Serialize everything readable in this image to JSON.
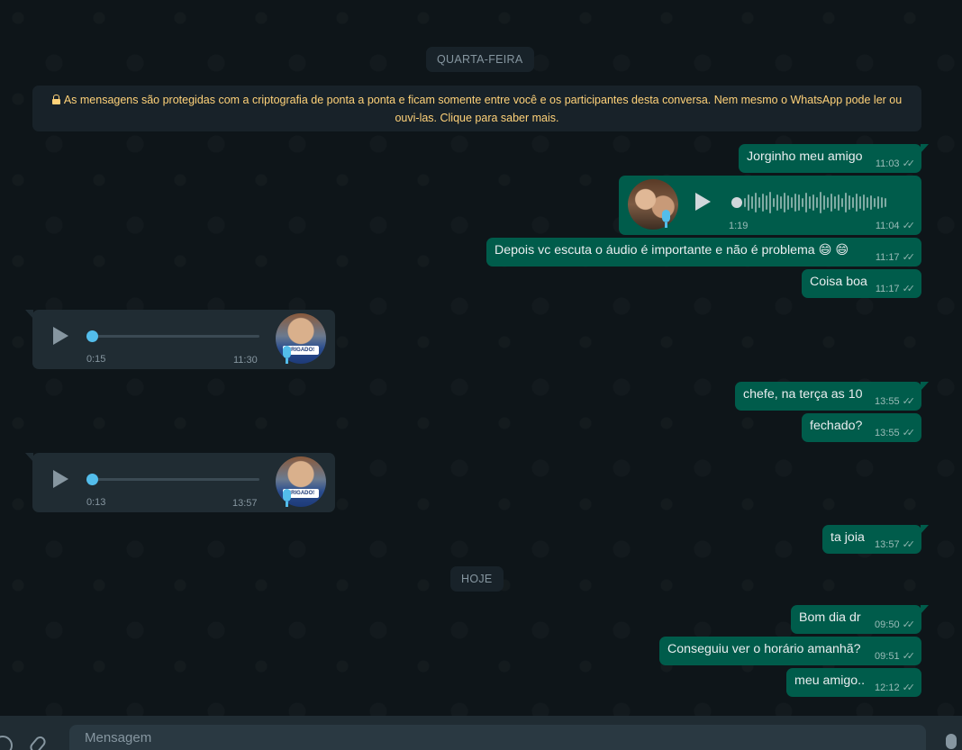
{
  "dates": {
    "wednesday": "QUARTA-FEIRA",
    "today": "HOJE"
  },
  "notice": "As mensagens são protegidas com a criptografia de ponta a ponta e ficam somente entre você e os participantes desta conversa. Nem mesmo o WhatsApp pode ler ou ouvi-las. Clique para saber mais.",
  "messages": {
    "m1": {
      "text": "Jorginho meu amigo",
      "time": "11:03"
    },
    "audio_out": {
      "duration": "1:19",
      "time": "11:04"
    },
    "m2": {
      "text": "Depois vc escuta o áudio é importante e não é problema 😄 😄",
      "time": "11:17"
    },
    "m3": {
      "text": "Coisa boa",
      "time": "11:17"
    },
    "audio_in_1": {
      "duration": "0:15",
      "time": "11:30",
      "badge": "BRIGADO!"
    },
    "m4": {
      "text": "chefe, na terça as 10",
      "time": "13:55"
    },
    "m5": {
      "text": "fechado?",
      "time": "13:55"
    },
    "audio_in_2": {
      "duration": "0:13",
      "time": "13:57",
      "badge": "BRIGADO!"
    },
    "m6": {
      "text": "ta joia",
      "time": "13:57"
    },
    "m7": {
      "text": "Bom dia dr",
      "time": "09:50"
    },
    "m8": {
      "text": "Conseguiu ver o horário amanhã?",
      "time": "09:51"
    },
    "m9": {
      "text": "meu amigo..",
      "time": "12:12"
    }
  },
  "composer": {
    "placeholder": "Mensagem"
  },
  "colors": {
    "outgoing": "#005c4b",
    "incoming": "#202c33",
    "accent": "#53bdeb",
    "notice_text": "#ffd279"
  }
}
